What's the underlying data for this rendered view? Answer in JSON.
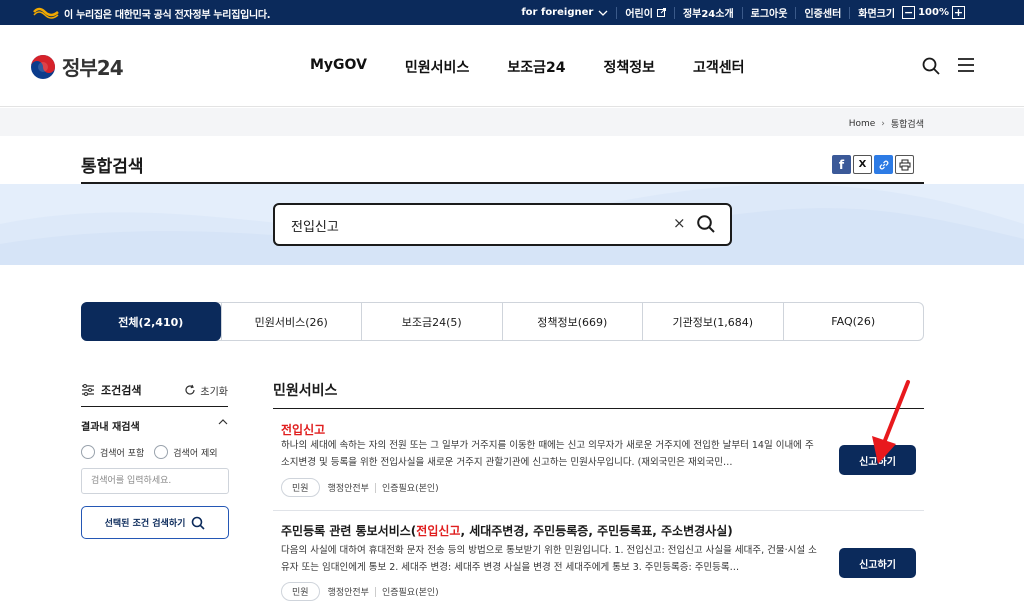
{
  "topbar": {
    "gov_notice": "이 누리집은 대한민국 공식 전자정부 누리집입니다.",
    "foreigner": "for foreigner",
    "kids": "어린이",
    "about": "정부24소개",
    "logout": "로그아웃",
    "cert": "인증센터",
    "zoom_label": "화면크기",
    "zoom_minus": "−",
    "zoom_value": "100%",
    "zoom_plus": "+"
  },
  "header": {
    "logo_text": "정부24",
    "nav": [
      "MyGOV",
      "민원서비스",
      "보조금24",
      "정책정보",
      "고객센터"
    ]
  },
  "breadcrumb": {
    "home": "Home",
    "current": "통합검색"
  },
  "page_title": "통합검색",
  "share": {
    "facebook": "f",
    "x": "X"
  },
  "search": {
    "value": "전입신고",
    "clear": "×"
  },
  "tabs": [
    {
      "label": "전체(2,410)",
      "active": true
    },
    {
      "label": "민원서비스(26)"
    },
    {
      "label": "보조금24(5)"
    },
    {
      "label": "정책정보(669)"
    },
    {
      "label": "기관정보(1,684)"
    },
    {
      "label": "FAQ(26)"
    }
  ],
  "filter": {
    "title": "조건검색",
    "reset": "초기화",
    "refine_title": "결과내 재검색",
    "include": "검색어 포함",
    "exclude": "검색어 제외",
    "input_placeholder": "검색어를 입력하세요.",
    "apply": "선택된 조건 검색하기"
  },
  "section_title": "민원서비스",
  "results": [
    {
      "title_hl": "전입신고",
      "title_pre": "",
      "title_post": "",
      "desc": "하나의 세대에 속하는 자의 전원 또는 그 일부가 거주지를 이동한 때에는 신고 의무자가 새로운 거주지에 전입한 날부터 14일 이내에 주소지변경 및 등록을 위한 전입사실을 새로운 거주지 관할기관에 신고하는 민원사무입니다. (재외국민은 재외국민…",
      "chip": "민원",
      "agency": "행정안전부",
      "auth": "인증필요(본인)",
      "action": "신고하기"
    },
    {
      "title_pre": "주민등록 관련 통보서비스(",
      "title_hl": "전입신고",
      "title_post": ", 세대주변경, 주민등록증, 주민등록표, 주소변경사실)",
      "desc": "다음의 사실에 대하여 휴대전화 문자 전송 등의 방법으로 통보받기 위한 민원입니다. 1. 전입신고: 전입신고 사실을 세대주, 건물·시설 소유자 또는 임대인에게 통보 2. 세대주 변경: 세대주 변경 사실을 변경 전 세대주에게 통보 3. 주민등록증: 주민등록…",
      "chip": "민원",
      "agency": "행정안전부",
      "auth": "인증필요(본인)",
      "action": "신고하기"
    }
  ],
  "colors": {
    "navy": "#0b2a5b",
    "highlight": "#e01e1e",
    "band": "#e4eefb",
    "annotation_arrow": "#e8191d"
  }
}
